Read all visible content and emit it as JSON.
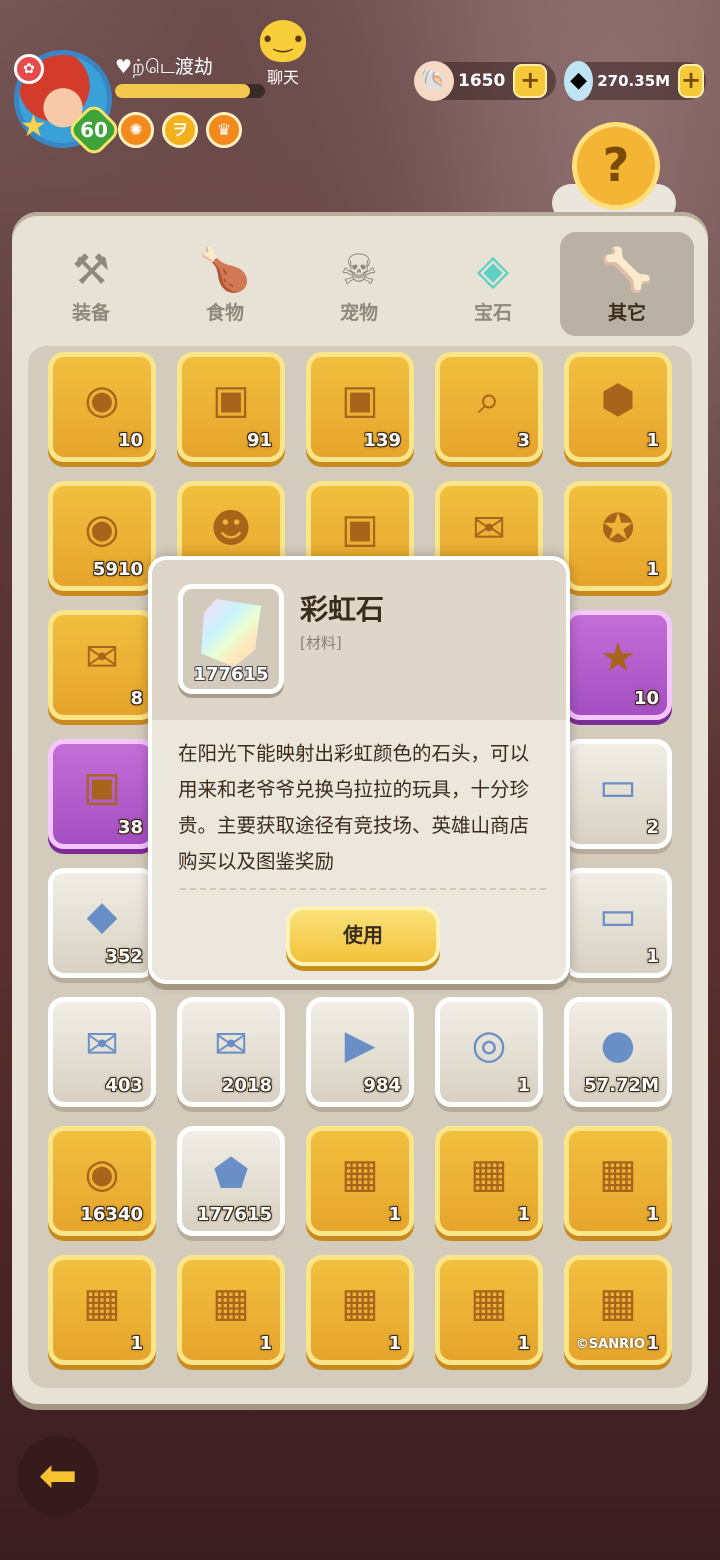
{
  "player": {
    "name": "♥ற்டெ渡劫",
    "level": "60",
    "xp_fraction": 0.9
  },
  "chat": {
    "label": "聊天"
  },
  "currency": {
    "shells": "1650",
    "gems": "270.35M"
  },
  "tabs": [
    {
      "label": "装备",
      "icon": "hammer-icon"
    },
    {
      "label": "食物",
      "icon": "food-basket-icon"
    },
    {
      "label": "宠物",
      "icon": "pet-skull-icon"
    },
    {
      "label": "宝石",
      "icon": "gem-icon"
    },
    {
      "label": "其它",
      "icon": "bone-icon",
      "active": true
    }
  ],
  "items": [
    {
      "count": "10",
      "icon": "coin-icon",
      "style": "gold"
    },
    {
      "count": "91",
      "icon": "chest-icon",
      "style": "gold"
    },
    {
      "count": "139",
      "icon": "chest-icon",
      "style": "gold"
    },
    {
      "count": "3",
      "icon": "magnifier-icon",
      "style": "gold"
    },
    {
      "count": "1",
      "icon": "badge-icon",
      "style": "gold"
    },
    {
      "count": "5910",
      "icon": "coin-icon",
      "style": "gold"
    },
    {
      "count": "",
      "icon": "silhouette-icon",
      "style": "gold"
    },
    {
      "count": "",
      "icon": "chest-icon",
      "style": "gold"
    },
    {
      "count": "",
      "icon": "ticket-icon",
      "style": "gold"
    },
    {
      "count": "1",
      "icon": "medal-icon",
      "style": "gold"
    },
    {
      "count": "8",
      "icon": "ticket-icon",
      "style": "gold"
    },
    {
      "count": "",
      "icon": "",
      "style": "gold"
    },
    {
      "count": "",
      "icon": "",
      "style": "gold"
    },
    {
      "count": "",
      "icon": "",
      "style": "gold"
    },
    {
      "count": "10",
      "icon": "star-icon",
      "style": "purple"
    },
    {
      "count": "38",
      "icon": "chest-icon",
      "style": "purple"
    },
    {
      "count": "",
      "icon": "",
      "style": "gold"
    },
    {
      "count": "",
      "icon": "",
      "style": "gold"
    },
    {
      "count": "",
      "icon": "",
      "style": "gold"
    },
    {
      "count": "2",
      "icon": "card-icon",
      "style": "white"
    },
    {
      "count": "352",
      "icon": "crystal-icon",
      "style": "white"
    },
    {
      "count": "",
      "icon": "",
      "style": "gold"
    },
    {
      "count": "",
      "icon": "",
      "style": "gold"
    },
    {
      "count": "",
      "icon": "",
      "style": "gold"
    },
    {
      "count": "1",
      "icon": "card-icon",
      "style": "white"
    },
    {
      "count": "403",
      "icon": "ticket-icon",
      "style": "white"
    },
    {
      "count": "2018",
      "icon": "ticket-icon",
      "style": "white"
    },
    {
      "count": "984",
      "icon": "scroll-icon",
      "style": "white"
    },
    {
      "count": "1",
      "icon": "shell-coin-icon",
      "style": "white"
    },
    {
      "count": "57.72M",
      "icon": "stone-icon",
      "style": "white"
    },
    {
      "count": "16340",
      "icon": "coin-icon",
      "style": "gold"
    },
    {
      "count": "177615",
      "icon": "rainbow-stone-icon",
      "style": "white"
    },
    {
      "count": "1",
      "icon": "photo-icon",
      "style": "gold"
    },
    {
      "count": "1",
      "icon": "photo-icon",
      "style": "gold"
    },
    {
      "count": "1",
      "icon": "photo-icon",
      "style": "gold"
    },
    {
      "count": "1",
      "icon": "photo-icon",
      "style": "gold"
    },
    {
      "count": "1",
      "icon": "photo-icon",
      "style": "gold"
    },
    {
      "count": "1",
      "icon": "photo-icon",
      "style": "gold"
    },
    {
      "count": "1",
      "icon": "photo-icon",
      "style": "gold"
    },
    {
      "count": "1",
      "icon": "photo-icon",
      "style": "gold"
    }
  ],
  "popup": {
    "title": "彩虹石",
    "type": "[材料]",
    "count": "177615",
    "description": "在阳光下能映射出彩虹颜色的石头，可以用来和老爷爷兑换乌拉拉的玩具，十分珍贵。主要获取途径有竞技场、英雄山商店购买以及图鉴奖励",
    "use_label": "使用"
  },
  "watermark": "©SANRIO"
}
